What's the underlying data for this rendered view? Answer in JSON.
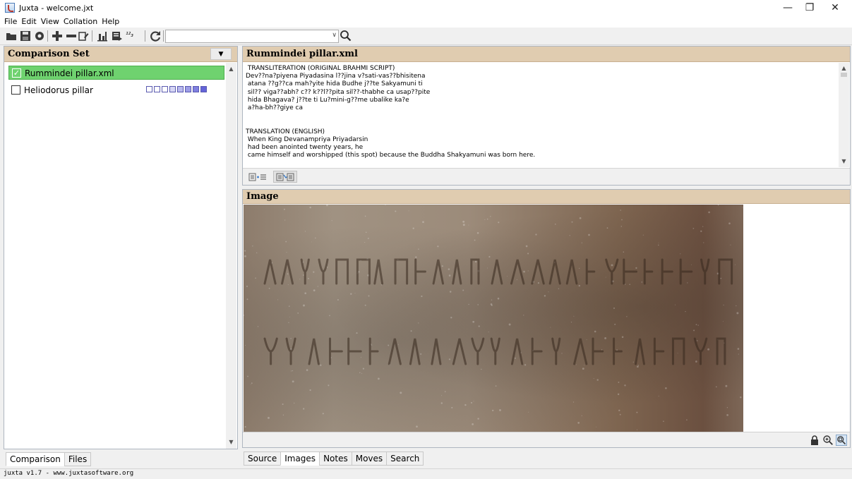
{
  "window": {
    "title": "Juxta - welcome.jxt",
    "minimize": "—",
    "restore": "❐",
    "close": "✕"
  },
  "menu": [
    "File",
    "Edit",
    "View",
    "Collation",
    "Help"
  ],
  "toolbar": {
    "icons": [
      "open-folder-icon",
      "save-icon",
      "settings-icon",
      "add-icon",
      "remove-icon",
      "edit-icon",
      "chart-icon",
      "export-icon",
      "numbering-icon",
      "refresh-icon"
    ],
    "numbering_glyph": "¹²₃",
    "search_value": "",
    "combo_arrow": "∨"
  },
  "comparison_set": {
    "title": "Comparison Set",
    "dropdown_glyph": "▼",
    "documents": [
      {
        "label": "Rummindei pillar.xml",
        "selected": true,
        "checked": true
      },
      {
        "label": "Heliodorus pillar",
        "selected": false,
        "checked": false,
        "squares": [
          "#ffffff",
          "#ffffff",
          "#ffffff",
          "#d6d6f4",
          "#b9b9ee",
          "#9d9de6",
          "#8080df",
          "#6464d8"
        ]
      }
    ]
  },
  "left_tabs": [
    {
      "label": "Comparison",
      "active": true
    },
    {
      "label": "Files",
      "active": false
    }
  ],
  "document_panel": {
    "title": "Rummindei pillar.xml",
    "text_lines": [
      " TRANSLITERATION (ORIGINAL BRAHMI SCRIPT)",
      "Dev??na?piyena Piyadasina l??jina v?sati-vas??bhisitena",
      " atana ??g??ca mah?yite hida Budhe j??te Sakyamuni ti",
      " sil?? viga??abh? c?? k??l??pita sil??-thabhe ca usap??pite",
      " hida Bhagava? j??te ti Lu?mini-g??me ubalike ka?e",
      " a?ha-bh??giye ca",
      "",
      "",
      "TRANSLATION (ENGLISH)",
      " When King Devanampriya Priyadarsin",
      " had been anointed twenty years, he",
      " came himself and worshipped (this spot) because the Buddha Shakyamuni was born here."
    ],
    "view_buttons": [
      "side-by-side-view-icon",
      "edit-view-icon"
    ]
  },
  "image_panel": {
    "title": "Image",
    "tools": [
      "lock-icon",
      "zoom-in-icon",
      "zoom-fit-icon"
    ]
  },
  "right_tabs": [
    {
      "label": "Source",
      "active": false
    },
    {
      "label": "Images",
      "active": true
    },
    {
      "label": "Notes",
      "active": false
    },
    {
      "label": "Moves",
      "active": false
    },
    {
      "label": "Search",
      "active": false
    }
  ],
  "status": "juxta v1.7 - www.juxtasoftware.org",
  "colors": {
    "panel_header": "#e0ccb0",
    "selected_row": "#6fd26f"
  }
}
